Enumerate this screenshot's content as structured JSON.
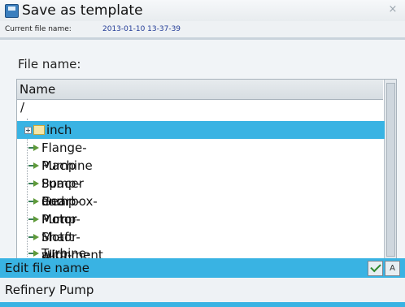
{
  "window": {
    "title": "Save as template",
    "close_symbol": "×"
  },
  "info": {
    "label": "Current file name:",
    "value": "2013-01-10 13-37-39"
  },
  "file_name_label": "File name:",
  "browser": {
    "column_header": "Name",
    "root": "/",
    "folders": [
      {
        "label": "inch",
        "selected": true
      }
    ],
    "files": [
      "Flange-Machine",
      "Pump Spacer and Motor",
      "Pump-Gearbox-Motor",
      "Pump-Motor",
      "Pump-Motor-with-spacer",
      "Shaft alignment template",
      "Turbine-Gearbox-Generator"
    ]
  },
  "edit": {
    "label": "Edit file name",
    "keyboard_symbol": "A"
  },
  "input": {
    "value": "Refinery Pump"
  },
  "colors": {
    "accent": "#39b3e3",
    "info_value": "#213a96"
  }
}
